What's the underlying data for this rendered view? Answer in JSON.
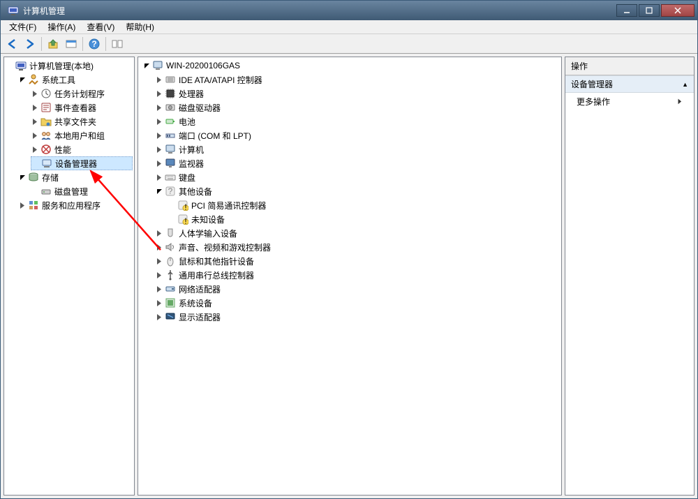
{
  "window": {
    "title": "计算机管理"
  },
  "menu": {
    "file": "文件(F)",
    "action": "操作(A)",
    "view": "查看(V)",
    "help": "帮助(H)"
  },
  "left_tree": {
    "root": "计算机管理(本地)",
    "system_tools": "系统工具",
    "task_scheduler": "任务计划程序",
    "event_viewer": "事件查看器",
    "shared_folders": "共享文件夹",
    "local_users": "本地用户和组",
    "performance": "性能",
    "device_manager": "设备管理器",
    "storage": "存储",
    "disk_management": "磁盘管理",
    "services_apps": "服务和应用程序"
  },
  "center_tree": {
    "computer_name": "WIN-20200106GAS",
    "ide": "IDE ATA/ATAPI 控制器",
    "processors": "处理器",
    "disk_drives": "磁盘驱动器",
    "battery": "电池",
    "ports": "端口 (COM 和 LPT)",
    "computer": "计算机",
    "monitors": "监视器",
    "keyboards": "键盘",
    "other_devices": "其他设备",
    "pci_comm": "PCI 简易通讯控制器",
    "unknown_device": "未知设备",
    "hid": "人体学输入设备",
    "sound": "声音、视频和游戏控制器",
    "mice": "鼠标和其他指针设备",
    "usb": "通用串行总线控制器",
    "network": "网络适配器",
    "system_devices": "系统设备",
    "display": "显示适配器"
  },
  "right_panel": {
    "header": "操作",
    "section": "设备管理器",
    "more_actions": "更多操作"
  }
}
